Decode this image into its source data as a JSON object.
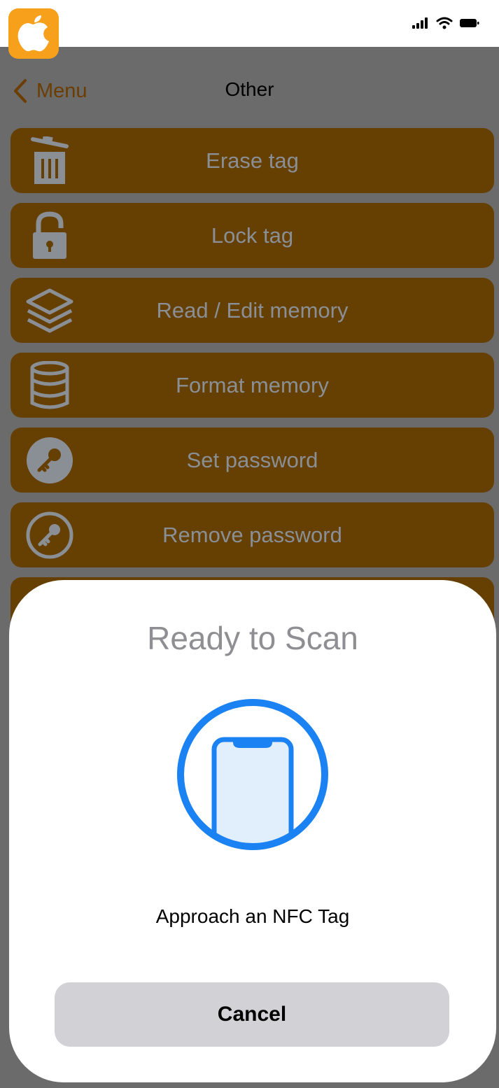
{
  "nav": {
    "back_label": "Menu",
    "title": "Other"
  },
  "menu": {
    "items": [
      {
        "label": "Erase tag",
        "icon": "trash-icon"
      },
      {
        "label": "Lock tag",
        "icon": "lock-icon"
      },
      {
        "label": "Read / Edit memory",
        "icon": "layers-icon"
      },
      {
        "label": "Format memory",
        "icon": "database-icon"
      },
      {
        "label": "Set password",
        "icon": "key-filled-icon"
      },
      {
        "label": "Remove password",
        "icon": "key-outline-icon"
      }
    ]
  },
  "scan_sheet": {
    "title": "Ready to Scan",
    "message": "Approach an NFC Tag",
    "cancel_label": "Cancel"
  },
  "colors": {
    "overlay": "#6b6b6b",
    "button_bg": "#654002",
    "accent_blue": "#1a82f2",
    "app_icon": "#f7a01c"
  }
}
